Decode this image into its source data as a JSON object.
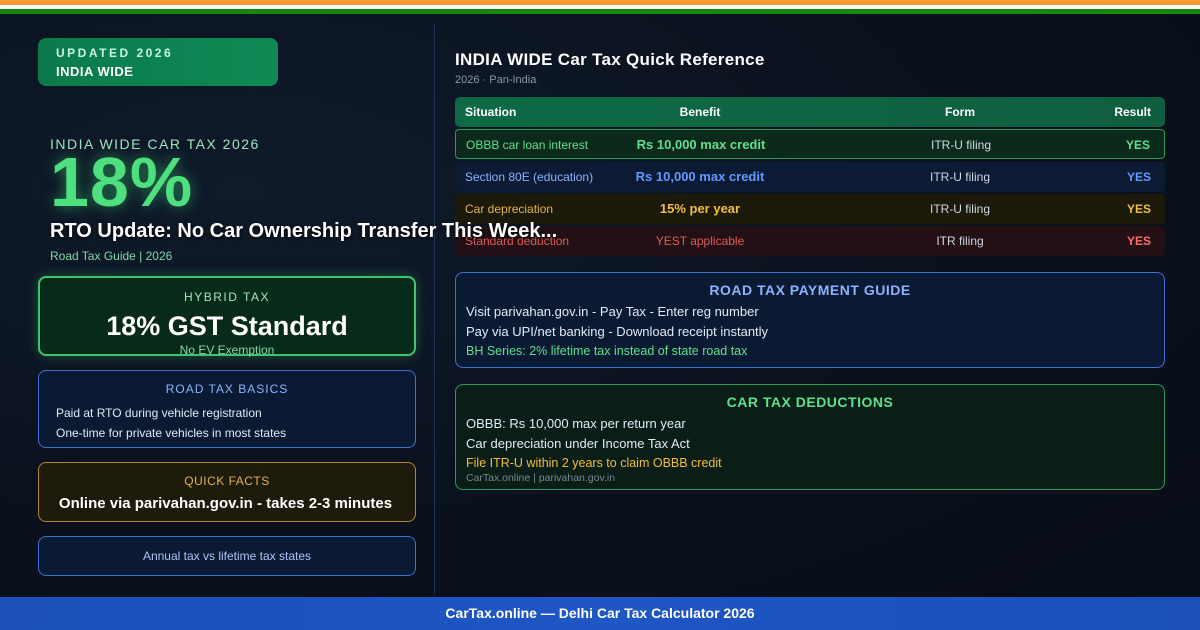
{
  "badge": {
    "line1": "UPDATED 2026",
    "line2": "INDIA WIDE"
  },
  "hero": {
    "kicker": "INDIA WIDE CAR TAX 2026",
    "big_value": "18%",
    "headline": "RTO Update: No Car Ownership Transfer This Week...",
    "subhead": "Road Tax Guide | 2026"
  },
  "hybrid_card": {
    "title": "HYBRID TAX",
    "value": "18% GST Standard",
    "note": "No EV Exemption"
  },
  "basics_card": {
    "title": "ROAD TAX BASICS",
    "items": [
      "Paid at RTO during vehicle registration",
      "One-time for private vehicles in most states"
    ]
  },
  "facts_card": {
    "title": "QUICK FACTS",
    "value": "Online via parivahan.gov.in - takes 2-3 minutes"
  },
  "annual_card": {
    "text": "Annual tax vs lifetime tax states"
  },
  "reference": {
    "title": "INDIA WIDE Car Tax Quick Reference",
    "subtitle": "2026 · Pan-India",
    "columns": [
      "Situation",
      "Benefit",
      "Form",
      "Result"
    ],
    "rows": [
      {
        "situation": "OBBB car loan interest",
        "benefit": "Rs 10,000 max credit",
        "form": "ITR-U filing",
        "result": "YES"
      },
      {
        "situation": "Section 80E (education)",
        "benefit": "Rs 10,000 max credit",
        "form": "ITR-U filing",
        "result": "YES"
      },
      {
        "situation": "Car depreciation",
        "benefit": "15% per year",
        "form": "ITR-U filing",
        "result": "YES"
      },
      {
        "situation": "Standard deduction",
        "benefit": "YEST applicable",
        "form": "ITR filing",
        "result": "YES"
      }
    ]
  },
  "payment_guide": {
    "title": "ROAD TAX PAYMENT GUIDE",
    "items": [
      "Visit parivahan.gov.in - Pay Tax - Enter reg number",
      "Pay via UPI/net banking - Download receipt instantly",
      "BH Series: 2% lifetime tax instead of state road tax"
    ]
  },
  "deductions": {
    "title": "CAR TAX DEDUCTIONS",
    "items": [
      "OBBB: Rs 10,000 max per return year",
      "Car depreciation under Income Tax Act",
      "File ITR-U within 2 years to claim OBBB credit"
    ],
    "source": "CarTax.online | parivahan.gov.in"
  },
  "footer": {
    "text": "CarTax.online — Delhi Car Tax Calculator 2026"
  },
  "colors": {
    "saffron": "#ff9933",
    "green": "#138808",
    "accent_green": "#4ee07f",
    "accent_blue": "#5e9bff",
    "accent_amber": "#f0bf40",
    "accent_red": "#ff6b6b",
    "footer_blue": "#1e56c4"
  }
}
